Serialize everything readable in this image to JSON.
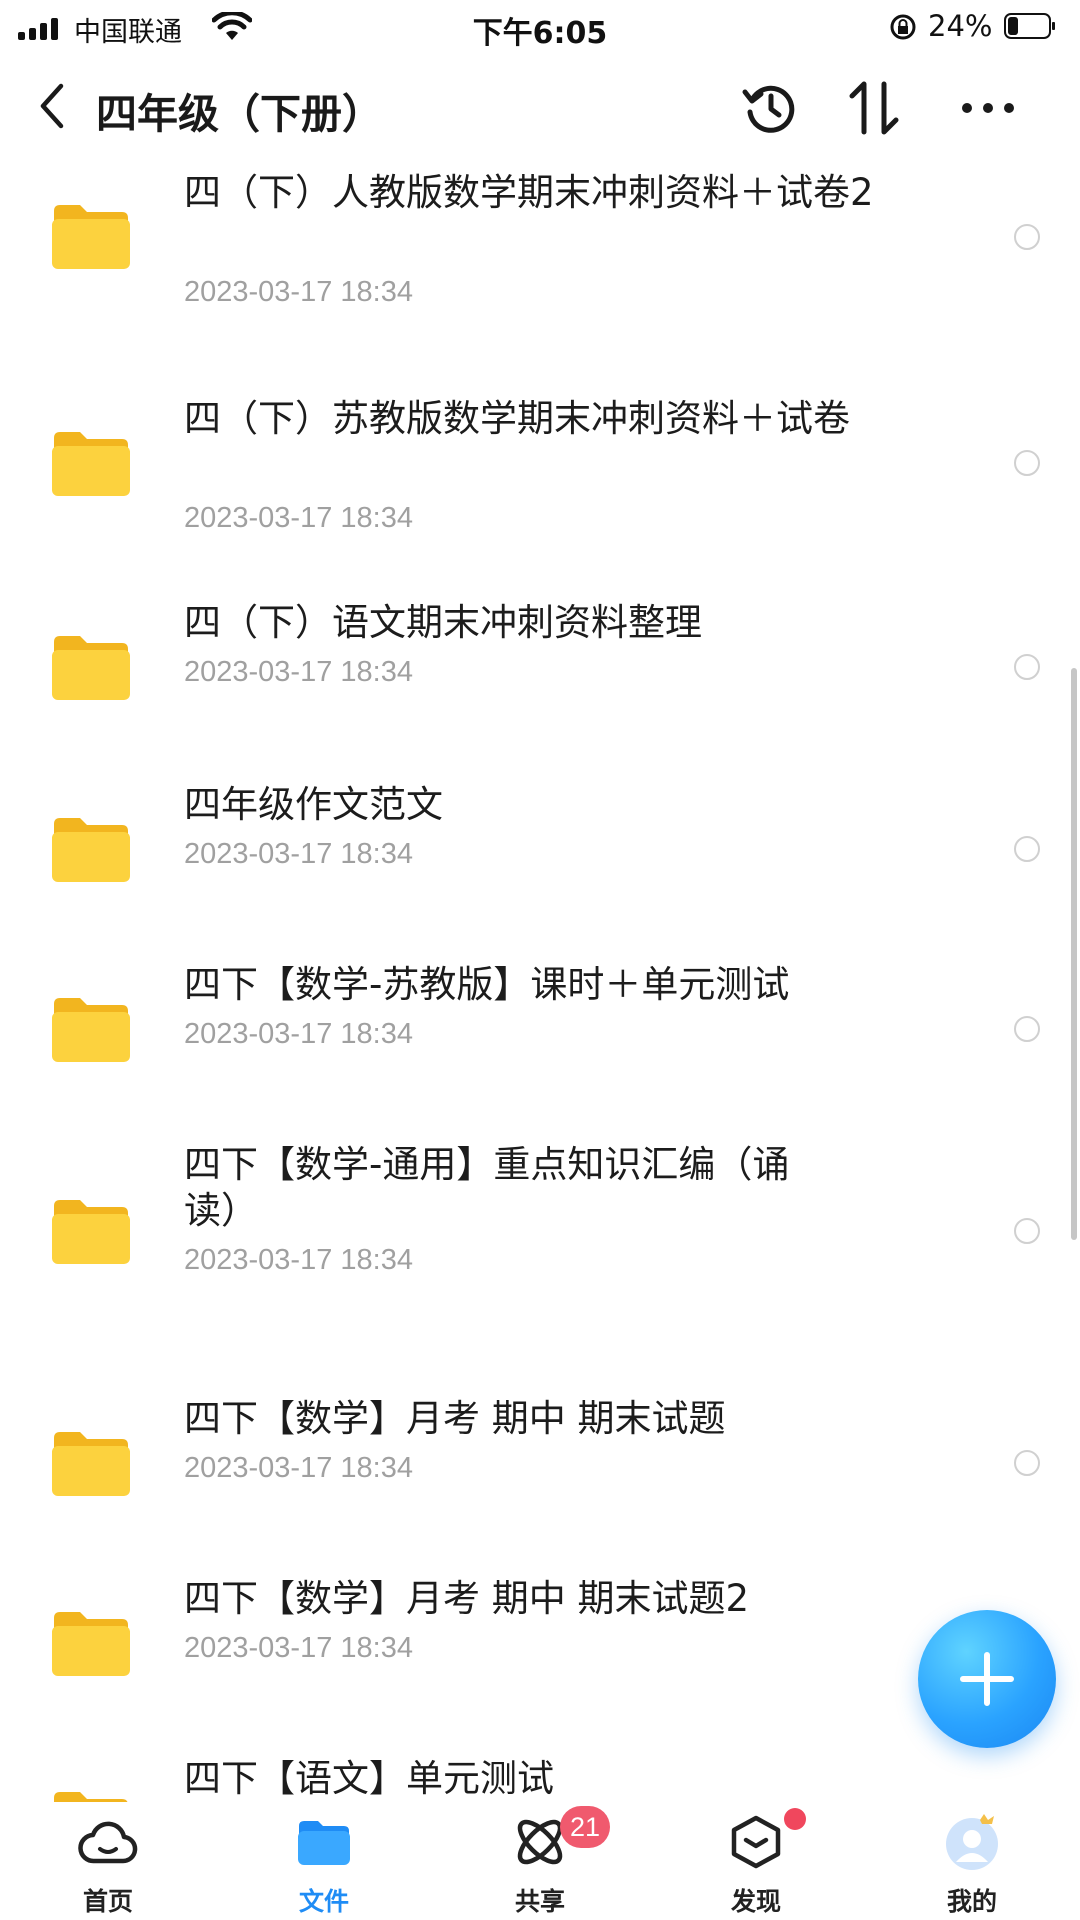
{
  "status_bar": {
    "carrier": "中国联通",
    "time": "下午6:05",
    "battery": "24%"
  },
  "nav": {
    "title": "四年级（下册）",
    "icons": [
      "back-icon",
      "history-icon",
      "sort-icon",
      "more-icon"
    ]
  },
  "files": [
    {
      "name": "四（下）人教版数学期末冲刺资料＋试卷2",
      "date": "2023-03-17 18:34"
    },
    {
      "name": "四（下）苏教版数学期末冲刺资料＋试卷",
      "date": "2023-03-17 18:34"
    },
    {
      "name": "四（下）语文期末冲刺资料整理",
      "date": "2023-03-17 18:34"
    },
    {
      "name": "四年级作文范文",
      "date": "2023-03-17 18:34"
    },
    {
      "name": "四下【数学-苏教版】课时＋单元测试",
      "date": "2023-03-17 18:34"
    },
    {
      "name": "四下【数学-通用】重点知识汇编（诵读）",
      "date": "2023-03-17 18:34"
    },
    {
      "name": "四下【数学】月考 期中 期末试题",
      "date": "2023-03-17 18:34"
    },
    {
      "name": "四下【数学】月考 期中 期末试题2",
      "date": "2023-03-17 18:34"
    },
    {
      "name": "四下【语文】单元测试",
      "date": ""
    }
  ],
  "tabs": [
    {
      "label": "首页",
      "icon": "cloud-icon"
    },
    {
      "label": "文件",
      "icon": "folder-icon",
      "active": true
    },
    {
      "label": "共享",
      "icon": "atom-icon",
      "badge": "21"
    },
    {
      "label": "发现",
      "icon": "cube-icon",
      "dot": true
    },
    {
      "label": "我的",
      "icon": "avatar-icon"
    }
  ],
  "colors": {
    "accent": "#1f8cf5",
    "folder": "#f7c52c",
    "badge": "#f05a6e"
  }
}
